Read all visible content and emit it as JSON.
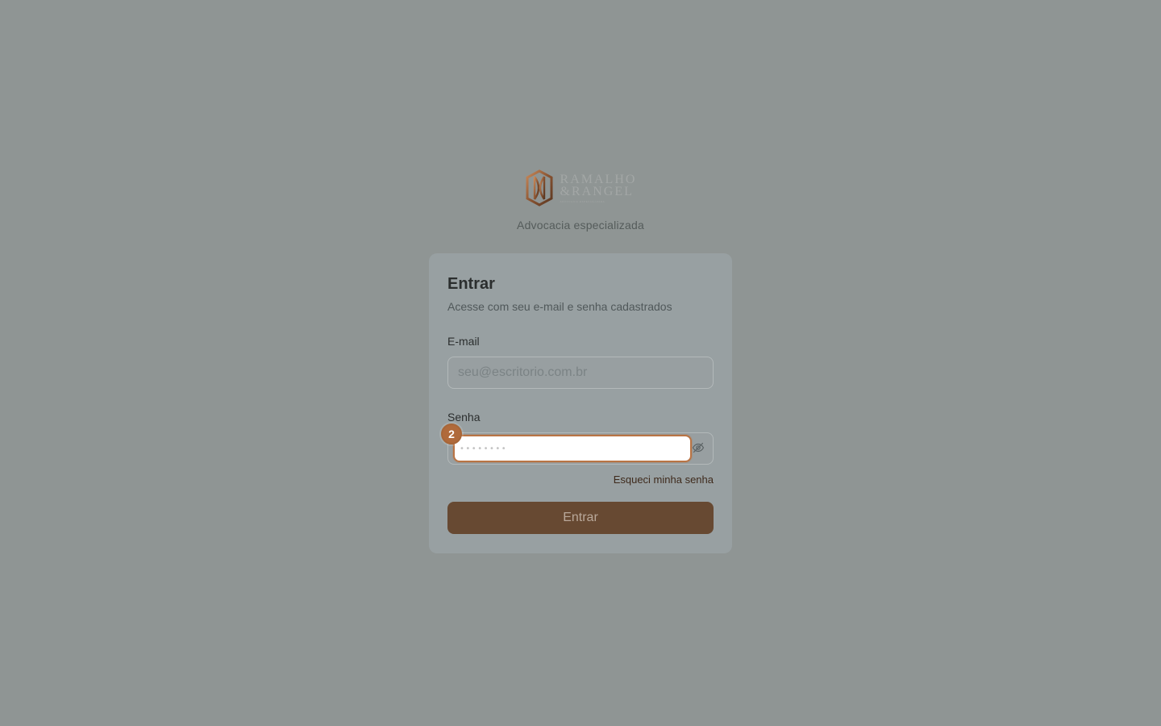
{
  "brand": {
    "logo_line1": "RAMALHO",
    "logo_line2": "&RANGEL",
    "logo_tag": "ADVOCACIA ESPECIALIZADA",
    "tagline": "Advocacia especializada"
  },
  "login": {
    "title": "Entrar",
    "subtitle": "Acesse com seu e-mail e senha cadastrados",
    "email_label": "E-mail",
    "email_placeholder": "seu@escritorio.com.br",
    "email_value": "",
    "password_label": "Senha",
    "password_placeholder": "••••••••",
    "password_value": "",
    "step_marker": "2",
    "forgot_label": "Esqueci minha senha",
    "submit_label": "Entrar"
  },
  "icons": {
    "logo": "ramalho-rangel-emblem-icon",
    "password_toggle": "eye-off-icon"
  },
  "colors": {
    "background": "#8f9594",
    "card": "#98a0a2",
    "accent": "#b06a3b",
    "button": "#674932",
    "link": "#3e2a1c"
  }
}
